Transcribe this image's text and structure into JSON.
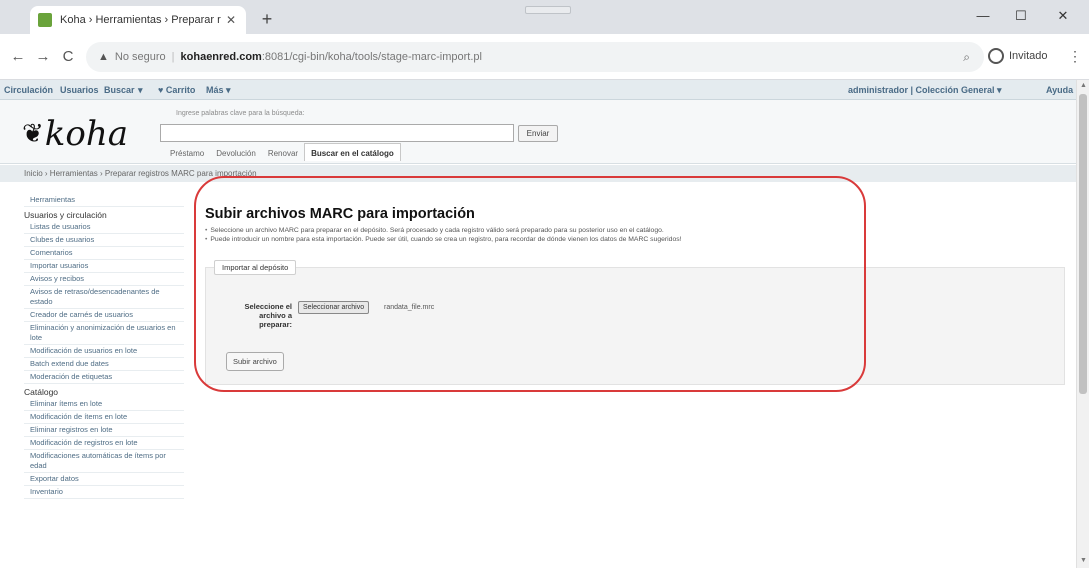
{
  "browser": {
    "tab_title": "Koha › Herramientas › Preparar r",
    "tab_close": "✕",
    "new_tab": "+",
    "url_insecure": "No seguro",
    "url_sep": "|",
    "url_host": "kohaenred.com",
    "url_path": ":8081/cgi-bin/koha/tools/stage-marc-import.pl",
    "profile_label": "Invitado",
    "win_min": "—",
    "win_max": "☐",
    "win_close": "✕",
    "back": "←",
    "forward": "→",
    "reload": "C",
    "warn": "▲",
    "zoom": "⌕",
    "kebab": "⋮"
  },
  "koha": {
    "top_nav": [
      "Circulación",
      "Usuarios",
      "Buscar",
      "▾",
      "♥ Carrito",
      "Más ▾"
    ],
    "top_right_user": "administrador | Colección General ▾",
    "top_right_help": "Ayuda",
    "logo_text": "koha",
    "logo_leaf": "❦",
    "search_hint": "Ingrese palabras clave para la búsqueda:",
    "search_button": "Enviar",
    "search_tabs": [
      "Préstamo",
      "Devolución",
      "Renovar",
      "Buscar en el catálogo"
    ],
    "breadcrumb": "Inicio › Herramientas › Preparar registros MARC para importación",
    "sidebar": {
      "top": "Herramientas",
      "group1_title": "Usuarios y circulación",
      "group1_items": [
        "Listas de usuarios",
        "Clubes de usuarios",
        "Comentarios",
        "Importar usuarios",
        "Avisos y recibos",
        "Avisos de retraso/desencadenantes de estado",
        "Creador de carnés de usuarios",
        "Eliminación y anonimización de usuarios en lote",
        "Modificación de usuarios en lote",
        "Batch extend due dates",
        "Moderación de etiquetas"
      ],
      "group2_title": "Catálogo",
      "group2_items": [
        "Eliminar ítems en lote",
        "Modificación de ítems en lote",
        "Eliminar registros en lote",
        "Modificación de registros en lote",
        "Modificaciones automáticas de ítems por edad",
        "Exportar datos",
        "Inventario"
      ]
    },
    "main": {
      "title": "Subir archivos MARC para importación",
      "bullet1": "Seleccione un archivo MARC para preparar en el depósito. Será procesado y cada registro válido será preparado para su posterior uso en el catálogo.",
      "bullet2": "Puede introducir un nombre para esta importación. Puede ser útil, cuando se crea un registro, para recordar de dónde vienen los datos de MARC sugeridos!",
      "legend": "Importar al depósito",
      "file_label": "Seleccione el archivo a preparar:",
      "file_button": "Seleccionar archivo",
      "file_name": "randata_file.mrc",
      "submit_button": "Subir archivo"
    }
  }
}
